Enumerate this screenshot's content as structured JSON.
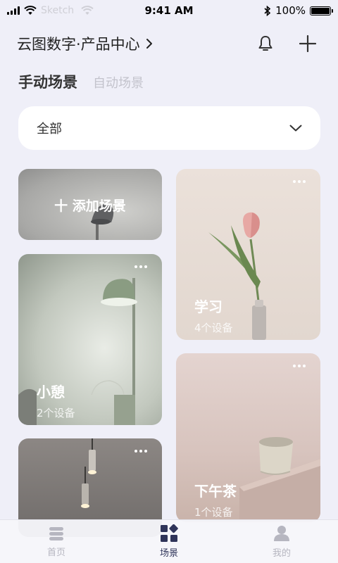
{
  "status_bar": {
    "carrier": "Sketch",
    "time": "9:41 AM",
    "battery": "100%"
  },
  "header": {
    "home_title": "云图数字·产品中心",
    "bell_icon": "bell-icon",
    "add_icon": "plus-icon"
  },
  "tabs": [
    {
      "label": "手动场景",
      "active": true
    },
    {
      "label": "自动场景",
      "active": false
    }
  ],
  "filter": {
    "selected": "全部"
  },
  "add_scene": {
    "label": "添加场景"
  },
  "scenes": [
    {
      "name": "学习",
      "devices": "4个设备"
    },
    {
      "name": "小憩",
      "devices": "2个设备"
    },
    {
      "name": "下午茶",
      "devices": "1个设备"
    }
  ],
  "bottom_nav": [
    {
      "label": "首页",
      "icon": "layers-icon",
      "active": false
    },
    {
      "label": "场景",
      "icon": "scene-grid-icon",
      "active": true
    },
    {
      "label": "我的",
      "icon": "user-icon",
      "active": false
    }
  ],
  "colors": {
    "background": "#efeff8",
    "active_nav": "#2f3459",
    "inactive_nav": "#b6b6c0"
  }
}
